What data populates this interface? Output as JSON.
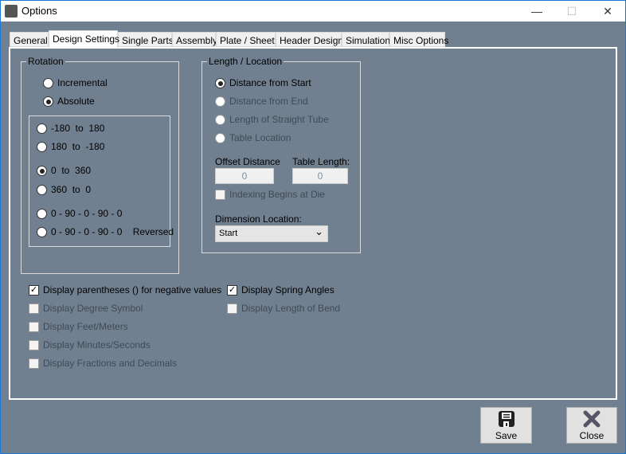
{
  "window": {
    "title": "Options",
    "minimize": "—",
    "maximize": "☐",
    "close": "✕"
  },
  "tabs": [
    "General",
    "Design Settings",
    "Single Parts",
    "Assembly",
    "Plate / Sheet",
    "Header Design",
    "Simulation",
    "Misc Options"
  ],
  "rotation": {
    "label": "Rotation",
    "modes": [
      {
        "label": "Incremental",
        "selected": false
      },
      {
        "label": "Absolute",
        "selected": true
      }
    ],
    "ranges": [
      {
        "label": "-180  to  180",
        "selected": false
      },
      {
        "label": "180  to  -180",
        "selected": false
      },
      {
        "label": "0  to  360",
        "selected": true
      },
      {
        "label": "360  to  0",
        "selected": false
      },
      {
        "label": "0 - 90 - 0 - 90 - 0",
        "selected": false
      },
      {
        "label": "0 - 90 - 0 - 90 - 0    Reversed",
        "selected": false
      }
    ]
  },
  "length": {
    "label": "Length / Location",
    "options": [
      {
        "label": "Distance from Start",
        "selected": true,
        "enabled": true
      },
      {
        "label": "Distance from End",
        "enabled": false
      },
      {
        "label": "Length of Straight Tube",
        "enabled": false
      },
      {
        "label": "Table Location",
        "enabled": false
      }
    ],
    "offset_label": "Offset Distance",
    "offset_value": "0",
    "table_label": "Table Length:",
    "table_value": "0",
    "indexing_label": "Indexing Begins at Die",
    "dimension_label": "Dimension Location:",
    "dimension_value": "Start"
  },
  "checks_left": [
    {
      "label": "Display parentheses () for negative values",
      "checked": true,
      "enabled": true
    },
    {
      "label": "Display Degree Symbol",
      "checked": false,
      "enabled": false
    },
    {
      "label": "Display Feet/Meters",
      "checked": false,
      "enabled": false
    },
    {
      "label": "Display Minutes/Seconds",
      "checked": false,
      "enabled": false
    },
    {
      "label": "Display Fractions and Decimals",
      "checked": false,
      "enabled": false
    }
  ],
  "checks_right": [
    {
      "label": "Display Spring Angles",
      "checked": true,
      "enabled": true
    },
    {
      "label": "Display Length of Bend",
      "checked": false,
      "enabled": false
    }
  ],
  "buttons": {
    "save": "Save",
    "close": "Close"
  }
}
